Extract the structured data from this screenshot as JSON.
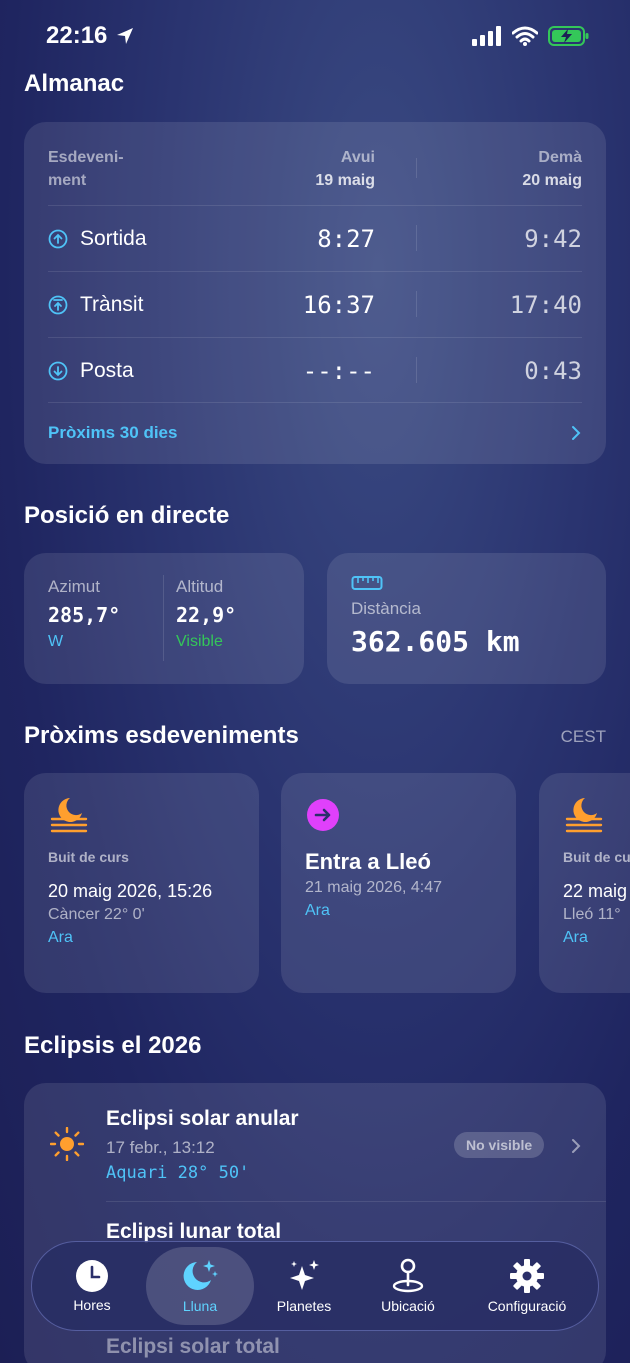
{
  "status": {
    "time": "22:16"
  },
  "almanac": {
    "title": "Almanac",
    "col_event": "Esdeveni-ment",
    "col_today": "Avui",
    "col_today_date": "19 maig",
    "col_tomorrow": "Demà",
    "col_tomorrow_date": "20 maig",
    "rows": [
      {
        "label": "Sortida",
        "today": "8:27",
        "tomorrow": "9:42",
        "icon": "arrow-up-circle-icon"
      },
      {
        "label": "Trànsit",
        "today": "16:37",
        "tomorrow": "17:40",
        "icon": "arrow-up-bar-circle-icon"
      },
      {
        "label": "Posta",
        "today": "--:--",
        "tomorrow": "0:43",
        "icon": "arrow-down-circle-icon"
      }
    ],
    "link": "Pròxims 30 dies"
  },
  "position": {
    "title": "Posició en directe",
    "azimuth_label": "Azimut",
    "azimuth_value": "285,7°",
    "azimuth_dir": "W",
    "altitude_label": "Altitud",
    "altitude_value": "22,9°",
    "altitude_status": "Visible",
    "distance_label": "Distància",
    "distance_value": "362.605 km"
  },
  "events": {
    "title": "Pròxims esdeveniments",
    "timezone": "CEST",
    "cards": [
      {
        "label": "Buit de curs",
        "title": "20 maig 2026, 15:26",
        "sub": "Càncer 22° 0'",
        "now": "Ara"
      },
      {
        "title": "Entra a Lleó",
        "sub": "21 maig 2026, 4:47",
        "now": "Ara"
      },
      {
        "label": "Buit de cu",
        "title": "22 maig",
        "sub": "Lleó 11°",
        "now": "Ara"
      }
    ]
  },
  "eclipses": {
    "title": "Eclipsis el 2026",
    "rows": [
      {
        "title": "Eclipsi solar anular",
        "date": "17 febr., 13:12",
        "sign": "Aquari 28° 50'",
        "badge": "No visible"
      },
      {
        "title": "Eclipsi lunar total",
        "date": "",
        "sign": "",
        "badge": ""
      },
      {
        "title": "Eclipsi solar total",
        "date": "",
        "sign": "",
        "badge": ""
      }
    ]
  },
  "tabs": [
    {
      "label": "Hores",
      "icon": "clock-icon"
    },
    {
      "label": "Lluna",
      "icon": "moon-stars-icon"
    },
    {
      "label": "Planetes",
      "icon": "sparkles-icon"
    },
    {
      "label": "Ubicació",
      "icon": "location-pin-icon"
    },
    {
      "label": "Configuració",
      "icon": "gear-icon"
    }
  ],
  "colors": {
    "accent": "#4fc3f7",
    "orange": "#ff9f2e",
    "magenta": "#e040fb",
    "green": "#34c759"
  }
}
